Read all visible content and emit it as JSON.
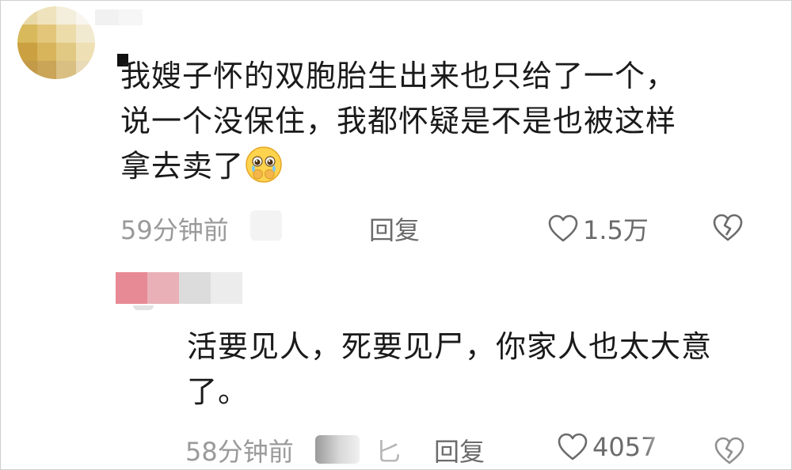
{
  "comment1": {
    "lines": [
      "我嫂子怀的双胞胎生出来也只给了一个，",
      "说一个没保住，我都怀疑是不是也被这样",
      "拿去卖了"
    ],
    "time": "59分钟前",
    "reply_label": "回复",
    "like_count": "1.5万"
  },
  "comment2": {
    "lines": [
      "活要见人，死要见尸，你家人也太大意",
      "了。"
    ],
    "time": "58分钟前",
    "location_partial": "匕",
    "reply_label": "回复",
    "like_count": "4057"
  },
  "colors": {
    "text": "#1a1a1a",
    "meta": "#9a9a9a",
    "action": "#6b6b6b"
  },
  "icons": [
    "avatar-mosaic",
    "crying-emoji",
    "heart-icon",
    "broken-heart-icon"
  ]
}
